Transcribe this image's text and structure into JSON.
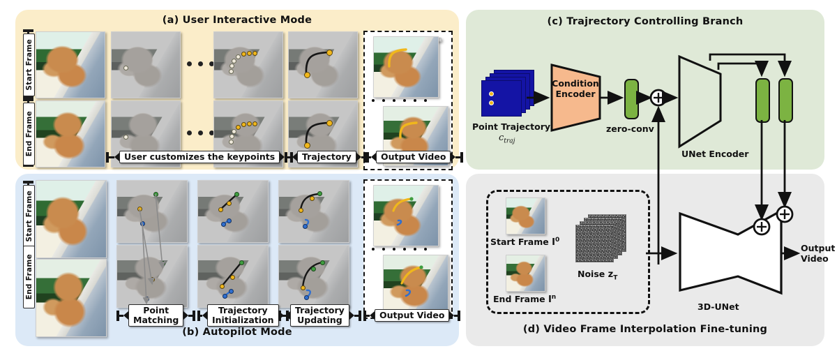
{
  "panels": {
    "a": {
      "title": "(a) User Interactive Mode"
    },
    "b": {
      "title": "(b) Autopilot Mode"
    },
    "c": {
      "title": "(c) Trajrectory Controlling Branch"
    },
    "d": {
      "title": "(d) Video Frame Interpolation Fine-tuning"
    }
  },
  "row_labels": {
    "start": "Start Frame",
    "end": "End Frame"
  },
  "a_brackets": [
    {
      "label": "User customizes the keypoints"
    },
    {
      "label": "Trajectory"
    },
    {
      "label": "Output Video"
    }
  ],
  "b_brackets": [
    {
      "label": "Point\nMatching"
    },
    {
      "label": "Trajectory\nInitialization"
    },
    {
      "label": "Trajectory\nUpdating"
    },
    {
      "label": "Output Video"
    }
  ],
  "c": {
    "point_trajectory_label": "Point Trajectory",
    "point_trajectory_symbol": "c",
    "point_trajectory_subscript": "traj",
    "condition_encoder": "Condition\nEncoder",
    "condition_encoder_line1": "Condition",
    "condition_encoder_line2": "Encoder",
    "zero_conv": "zero-conv",
    "unet_encoder": "UNet Encoder",
    "plus_symbol": "+"
  },
  "d": {
    "start_frame": "Start Frame",
    "start_frame_symbol": "I",
    "start_frame_superscript": "0",
    "end_frame": "End Frame",
    "end_frame_symbol": "I",
    "end_frame_superscript": "n",
    "noise": "Noise",
    "noise_symbol": "z",
    "noise_subscript": "T",
    "unet3d": "3D-UNet",
    "output_video_line1": "Output",
    "output_video_line2": "Video",
    "plus_symbol": "+"
  },
  "colors": {
    "panel_a_bg": "#fbedc9",
    "panel_b_bg": "#dce9f7",
    "panel_c_bg": "#dfe9d7",
    "panel_d_bg": "#eaeaea",
    "condition_encoder": "#f6b98d",
    "zero_conv_green": "#7cb342",
    "point_trajectory_blue": "#1414a5",
    "keypoint_yellow": "#f0b71c",
    "keypoint_green": "#3f9e3f",
    "keypoint_blue": "#2f6fd0",
    "stroke": "#111111"
  }
}
